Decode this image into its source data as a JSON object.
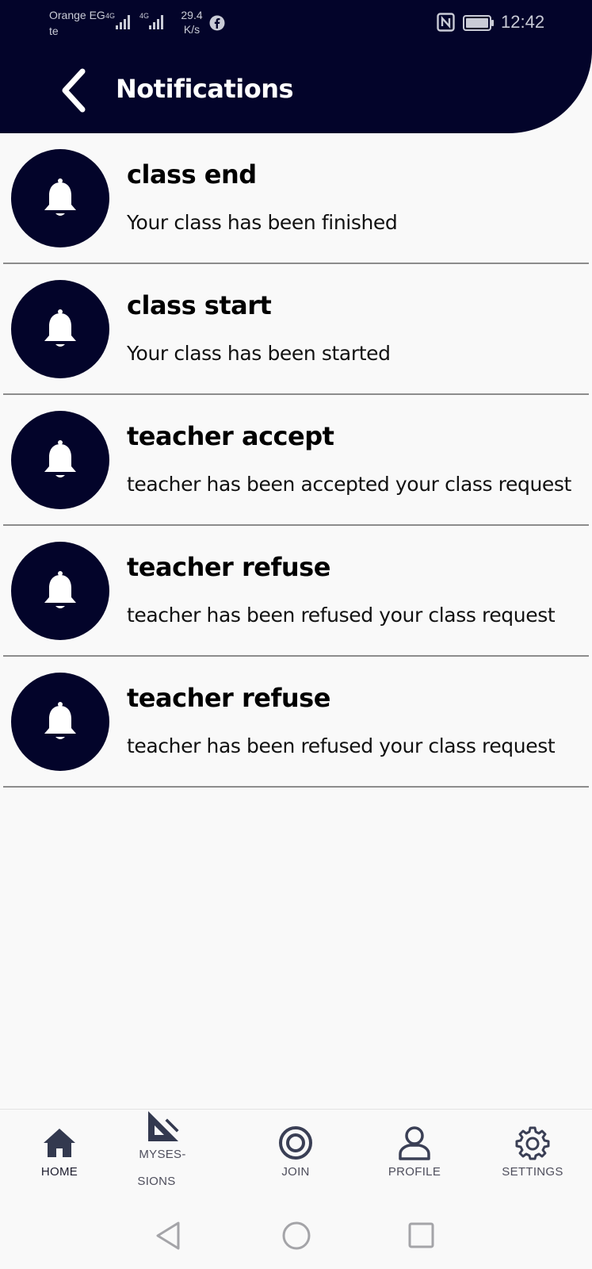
{
  "status_bar": {
    "carrier": "Orange EG te",
    "net_speed_value": "29.4",
    "net_speed_unit": "K/s",
    "time": "12:42",
    "icons": [
      "signal-4g-icon",
      "signal-4g-icon",
      "facebook-icon",
      "nfc-icon",
      "battery-icon"
    ]
  },
  "header": {
    "title": "Notifications",
    "back_icon": "chevron-left-icon"
  },
  "notifications": [
    {
      "title": "class end",
      "body": "Your class has been finished",
      "icon": "bell-icon"
    },
    {
      "title": "class start",
      "body": "Your class has been started",
      "icon": "bell-icon"
    },
    {
      "title": "teacher accept",
      "body": "teacher has been accepted your class request",
      "icon": "bell-icon"
    },
    {
      "title": "teacher refuse",
      "body": "teacher has been refused your class request",
      "icon": "bell-icon"
    },
    {
      "title": "teacher refuse",
      "body": "teacher has been refused your class request",
      "icon": "bell-icon"
    }
  ],
  "bottom_nav": {
    "items": [
      {
        "label": "HOME",
        "icon": "home-icon",
        "active": true
      },
      {
        "label": "MYSES-",
        "label2": "SIONS",
        "icon": "set-square-icon"
      },
      {
        "label": "JOIN",
        "icon": "record-icon"
      },
      {
        "label": "PROFILE",
        "icon": "user-icon"
      },
      {
        "label": "SETTINGS",
        "icon": "gear-icon"
      }
    ]
  },
  "system_nav": [
    "back-triangle-icon",
    "home-circle-icon",
    "recents-square-icon"
  ],
  "colors": {
    "header_bg": "#03042a",
    "page_bg": "#f9f9f9",
    "avatar_bg": "#03042a",
    "divider": "#8c8c8c"
  }
}
